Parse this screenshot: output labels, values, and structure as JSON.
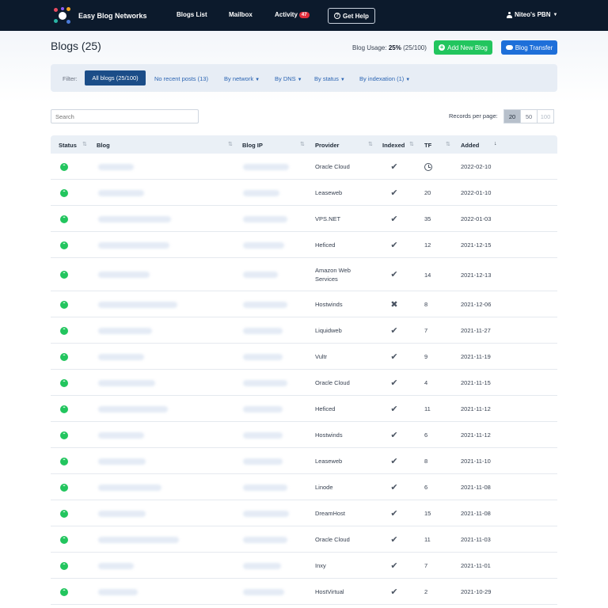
{
  "header": {
    "brand": "Easy Blog Networks",
    "nav": [
      {
        "label": "Blogs List"
      },
      {
        "label": "Mailbox"
      },
      {
        "label": "Activity",
        "badge": "47"
      }
    ],
    "help_label": "Get Help",
    "user_label": "Niteo's PBN"
  },
  "page": {
    "title": "Blogs (25)",
    "usage_prefix": "Blog Usage:",
    "usage_percent": "25%",
    "usage_count": "(25/100)",
    "add_label": "Add New Blog",
    "transfer_label": "Blog Transfer"
  },
  "filter": {
    "label": "Filter:",
    "active": "All blogs (25/100)",
    "links": [
      "No recent posts (13)",
      "By network",
      "By DNS",
      "By status",
      "By indexation (1)"
    ]
  },
  "search": {
    "placeholder": "Search"
  },
  "records": {
    "label": "Records per page:",
    "options": [
      "20",
      "50",
      "100"
    ],
    "selected": "20"
  },
  "table": {
    "headers": [
      "Status",
      "Blog",
      "Blog IP",
      "Provider",
      "Indexed",
      "TF",
      "Added"
    ],
    "rows": [
      {
        "provider": "Oracle Cloud",
        "indexed": true,
        "tf": "",
        "tf_pending": true,
        "added": "2022-02-10"
      },
      {
        "provider": "Leaseweb",
        "indexed": true,
        "tf": "20",
        "added": "2022-01-10"
      },
      {
        "provider": "VPS.NET",
        "indexed": true,
        "tf": "35",
        "added": "2022-01-03"
      },
      {
        "provider": "Heficed",
        "indexed": true,
        "tf": "12",
        "added": "2021-12-15"
      },
      {
        "provider": "Amazon Web Services",
        "indexed": true,
        "tf": "14",
        "added": "2021-12-13"
      },
      {
        "provider": "Hostwinds",
        "indexed": false,
        "tf": "8",
        "added": "2021-12-06"
      },
      {
        "provider": "Liquidweb",
        "indexed": true,
        "tf": "7",
        "added": "2021-11-27"
      },
      {
        "provider": "Vultr",
        "indexed": true,
        "tf": "9",
        "added": "2021-11-19"
      },
      {
        "provider": "Oracle Cloud",
        "indexed": true,
        "tf": "4",
        "added": "2021-11-15"
      },
      {
        "provider": "Heficed",
        "indexed": true,
        "tf": "11",
        "added": "2021-11-12"
      },
      {
        "provider": "Hostwinds",
        "indexed": true,
        "tf": "6",
        "added": "2021-11-12"
      },
      {
        "provider": "Leaseweb",
        "indexed": true,
        "tf": "8",
        "added": "2021-11-10"
      },
      {
        "provider": "Linode",
        "indexed": true,
        "tf": "6",
        "added": "2021-11-08"
      },
      {
        "provider": "DreamHost",
        "indexed": true,
        "tf": "15",
        "added": "2021-11-08"
      },
      {
        "provider": "Oracle Cloud",
        "indexed": true,
        "tf": "11",
        "added": "2021-11-03"
      },
      {
        "provider": "Inxy",
        "indexed": true,
        "tf": "7",
        "added": "2021-11-01"
      },
      {
        "provider": "HostVirtual",
        "indexed": true,
        "tf": "2",
        "added": "2021-10-29"
      }
    ]
  },
  "icons": {
    "status": "status-up-icon",
    "indexed_yes": "checkmark-icon",
    "indexed_no": "cross-icon",
    "tf_pending": "clock-icon",
    "sort": "sort-icon"
  },
  "colors": {
    "topbar": "#0c1a2c",
    "status_green": "#22c55e",
    "primary_blue": "#1e6fd9",
    "filter_active": "#1b4d88",
    "activity_badge": "#e02d3c"
  }
}
